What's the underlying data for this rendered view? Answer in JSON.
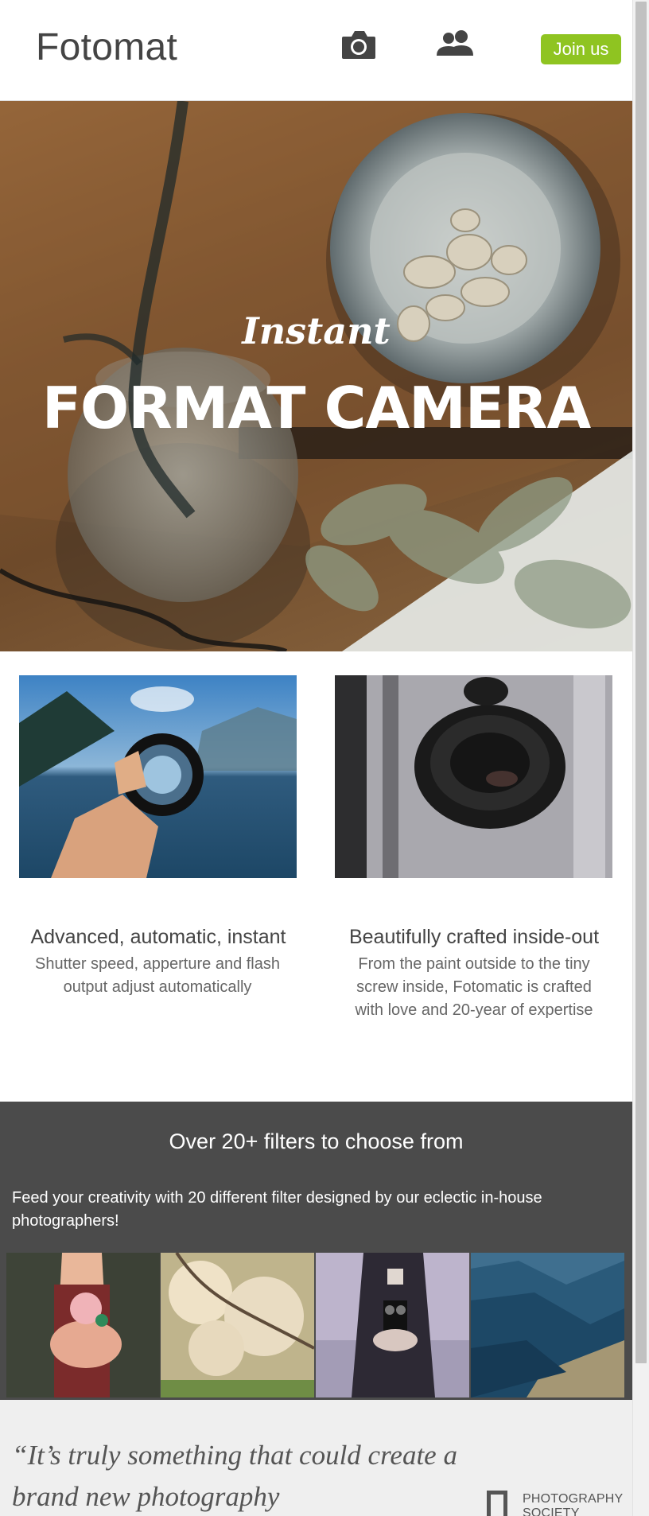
{
  "header": {
    "logo": "Fotomat",
    "nav_icons": [
      "camera-icon",
      "people-icon"
    ],
    "join_label": "Join us"
  },
  "hero": {
    "tagline": "Instant",
    "title": "FORMAT CAMERA"
  },
  "features": [
    {
      "title": "Advanced, automatic, instant",
      "description": "Shutter speed, apperture and flash output adjust automatically"
    },
    {
      "title": "Beautifully crafted inside-out",
      "description": "From the paint outside to the tiny screw inside, Fotomatic is crafted with love and 20-year of expertise"
    }
  ],
  "filters": {
    "title": "Over 20+ filters to choose from",
    "description": "Feed your creativity with 20 different filter designed by our eclectic in-house photographers!"
  },
  "testimonial": {
    "quote": "“It’s truly something that could create a brand new photography",
    "logo_text_1": "PHOTOGRAPHY",
    "logo_text_2": "SOCIETY"
  },
  "colors": {
    "accent": "#8fc421",
    "filters_bg": "#4b4b4b",
    "testimonial_bg": "#efefef"
  }
}
